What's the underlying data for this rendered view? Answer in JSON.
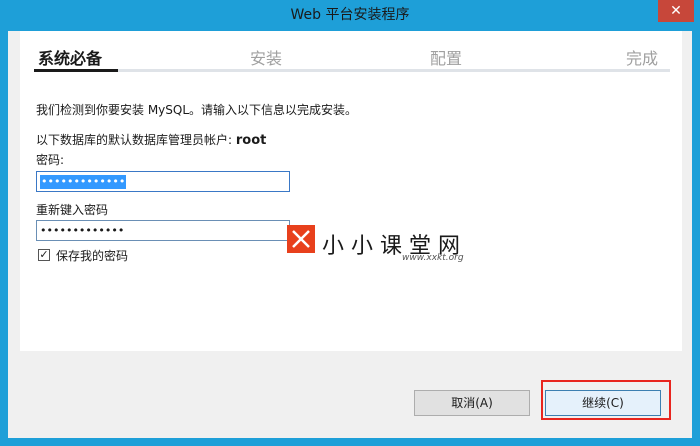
{
  "window": {
    "title": "Web 平台安装程序",
    "close_glyph": "✕"
  },
  "steps": [
    {
      "label": "系统必备",
      "active": true
    },
    {
      "label": "安装",
      "active": false
    },
    {
      "label": "配置",
      "active": false
    },
    {
      "label": "完成",
      "active": false
    }
  ],
  "content": {
    "intro": "我们检测到你要安装 MySQL。请输入以下信息以完成安装。",
    "admin_label": "以下数据库的默认数据库管理员帐户:",
    "admin_user": "root",
    "password_label": "密码:",
    "password_value": "•••••••••••••",
    "confirm_label": "重新键入密码",
    "confirm_value": "•••••••••••••",
    "save_password_label": "保存我的密码",
    "save_password_checked": true
  },
  "watermark": {
    "brand": "小小课堂网",
    "url": "www.xxkt.org"
  },
  "buttons": {
    "cancel": "取消(A)",
    "continue": "继续(C)"
  },
  "colors": {
    "titlebar": "#1e9fd8",
    "close": "#c7473a",
    "highlight": "#e8251e",
    "selection": "#3399ff"
  }
}
